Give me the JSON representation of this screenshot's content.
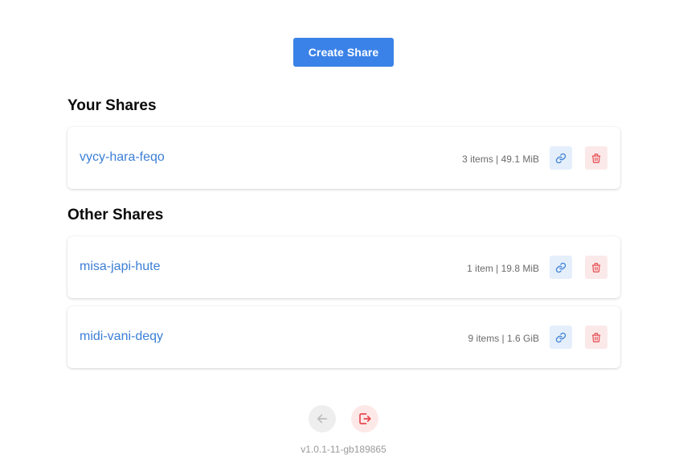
{
  "header": {
    "create_label": "Create Share"
  },
  "your_shares": {
    "title": "Your Shares",
    "items": [
      {
        "name": "vycy-hara-feqo",
        "meta": "3 items | 49.1 MiB"
      }
    ]
  },
  "other_shares": {
    "title": "Other Shares",
    "items": [
      {
        "name": "misa-japi-hute",
        "meta": "1 item | 19.8 MiB"
      },
      {
        "name": "midi-vani-deqy",
        "meta": "9 items | 1.6 GiB"
      }
    ]
  },
  "footer": {
    "version": "v1.0.1-11-gb189865"
  },
  "icons": {
    "link": "link-icon",
    "delete": "trash-icon",
    "back": "arrow-left-icon",
    "logout": "logout-icon"
  },
  "colors": {
    "primary": "#3b82e8",
    "link_text": "#3b7fd6",
    "danger": "#e5484d",
    "muted": "#9a9a9a"
  }
}
